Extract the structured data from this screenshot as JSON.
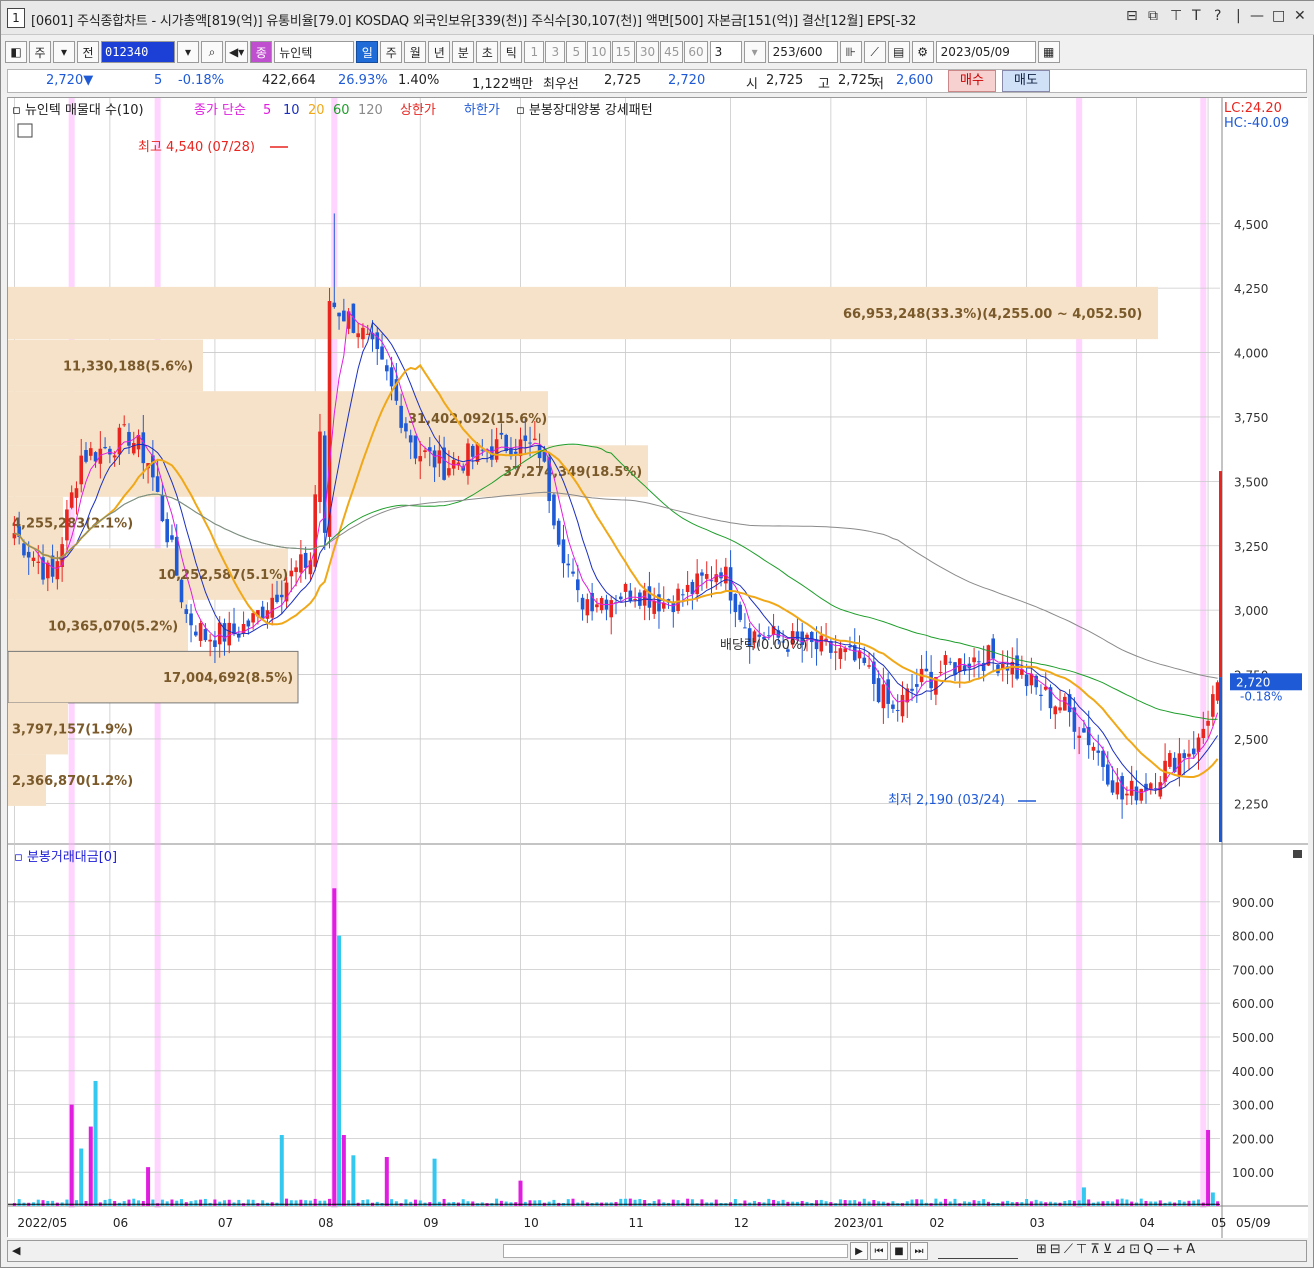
{
  "window": {
    "number": "1",
    "title": "[0601] 주식종합차트 - 시가총액[819(억)] 유통비율[79.0] KOSDAQ 외국인보유[339(천)] 주식수[30,107(천)] 액면[500] 자본금[151(억)] 결산[12월] EPS[-32",
    "ctrl": [
      "⊟",
      "⧉",
      "⊤",
      "T",
      "?",
      "|",
      "—",
      "□",
      "✕"
    ]
  },
  "toolbar": {
    "mode1": "주",
    "mode2": "전",
    "code": "012340",
    "search_icon": "search-icon",
    "name_badge": "종",
    "name": "뉴인텍",
    "periods": [
      "일",
      "주",
      "월",
      "년",
      "분",
      "초",
      "틱"
    ],
    "numbers": [
      "1",
      "3",
      "5",
      "10",
      "15",
      "30",
      "45",
      "60"
    ],
    "step": "3",
    "count": "253",
    "max": "/600",
    "date": "2023/05/09"
  },
  "quote": {
    "price": "2,720▼",
    "change": "5",
    "rate": "-0.18%",
    "volume": "422,664",
    "vol_rate": "26.93%",
    "turnover": "1.40%",
    "amount": "1,122백만",
    "best_ask_label": "최우선",
    "best_ask": "2,725",
    "best_bid": "2,720",
    "open_label": "시",
    "open": "2,725",
    "high_label": "고",
    "high": "2,725",
    "low_label": "저",
    "low": "2,600",
    "buy": "매수",
    "sell": "매도"
  },
  "legend": {
    "vp": "뉴인텍 매물대 수(10)",
    "ma": "종가 단순",
    "ma5": "5",
    "ma10": "10",
    "ma20": "20",
    "ma60": "60",
    "ma120": "120",
    "upper": "상한가",
    "lower": "하한가",
    "pattern": "분봉장대양봉 강세패턴",
    "lc": "LC:24.20",
    "hc": "HC:-40.09"
  },
  "colors": {
    "up": "#e8251f",
    "down": "#1f5ad6",
    "ma5": "#e01ee0",
    "ma10": "#1b2fbf",
    "ma20": "#f0a818",
    "ma60": "#1e9e2a",
    "ma120": "#8a8a8a",
    "profile": "#f6e2c8",
    "hl": "#ffb0ff"
  },
  "annotations": {
    "high": "최고 4,540 (07/28)",
    "low": "최저 2,190 (03/24)",
    "dividend": "배당락(0.00%)"
  },
  "price_axis": [
    "4,500",
    "4,250",
    "4,000",
    "3,750",
    "3,500",
    "3,250",
    "3,000",
    "2,750",
    "2,500",
    "2,250"
  ],
  "current_price": "2,720",
  "current_rate": "-0.18%",
  "volume_profile": [
    {
      "label": "66,953,248(33.3%)(4,255.00 ~ 4,052.50)"
    },
    {
      "label": "11,330,188(5.6%)"
    },
    {
      "label": "31,402,092(15.6%)"
    },
    {
      "label": "37,274,349(18.5%)"
    },
    {
      "label": "4,255,283(2.1%)"
    },
    {
      "label": "10,252,587(5.1%)"
    },
    {
      "label": "10,365,070(5.2%)"
    },
    {
      "label": "17,004,692(8.5%)"
    },
    {
      "label": "3,797,157(1.9%)"
    },
    {
      "label": "2,366,870(1.2%)"
    }
  ],
  "volume_panel": {
    "title": "분봉거래대금[0]",
    "axis": [
      "900.00",
      "800.00",
      "700.00",
      "600.00",
      "500.00",
      "400.00",
      "300.00",
      "200.00",
      "100.00"
    ]
  },
  "x_axis": [
    "2022/05",
    "06",
    "07",
    "08",
    "09",
    "10",
    "11",
    "12",
    "2023/01",
    "02",
    "03",
    "04",
    "05"
  ],
  "x_axis_end": "05/09",
  "chart_data": {
    "type": "candlestick",
    "ylim": [
      2100,
      4600
    ],
    "days": 253,
    "high": {
      "value": 4540,
      "date": "07/28"
    },
    "low": {
      "value": 2190,
      "date": "03/24"
    },
    "last_close": 2720,
    "close_path": [
      [
        0,
        3300
      ],
      [
        8,
        3120
      ],
      [
        14,
        3600
      ],
      [
        18,
        3620
      ],
      [
        24,
        3680
      ],
      [
        28,
        3580
      ],
      [
        32,
        3300
      ],
      [
        36,
        2980
      ],
      [
        40,
        2900
      ],
      [
        46,
        2910
      ],
      [
        50,
        2960
      ],
      [
        56,
        3100
      ],
      [
        62,
        3200
      ],
      [
        66,
        4200
      ],
      [
        72,
        4100
      ],
      [
        78,
        3900
      ],
      [
        84,
        3620
      ],
      [
        90,
        3560
      ],
      [
        96,
        3600
      ],
      [
        104,
        3650
      ],
      [
        110,
        3620
      ],
      [
        114,
        3300
      ],
      [
        118,
        3040
      ],
      [
        124,
        3050
      ],
      [
        130,
        3080
      ],
      [
        136,
        3030
      ],
      [
        142,
        3080
      ],
      [
        148,
        3170
      ],
      [
        154,
        2910
      ],
      [
        160,
        2890
      ],
      [
        166,
        2860
      ],
      [
        172,
        2840
      ],
      [
        178,
        2780
      ],
      [
        184,
        2600
      ],
      [
        190,
        2730
      ],
      [
        196,
        2780
      ],
      [
        202,
        2820
      ],
      [
        208,
        2800
      ],
      [
        214,
        2690
      ],
      [
        220,
        2620
      ],
      [
        226,
        2480
      ],
      [
        232,
        2270
      ],
      [
        238,
        2340
      ],
      [
        244,
        2440
      ],
      [
        248,
        2480
      ],
      [
        252,
        2720
      ]
    ]
  },
  "volume_bars": [
    {
      "day": 12,
      "value": 300
    },
    {
      "day": 14,
      "value": 170
    },
    {
      "day": 16,
      "value": 235
    },
    {
      "day": 17,
      "value": 370
    },
    {
      "day": 28,
      "value": 115
    },
    {
      "day": 56,
      "value": 210
    },
    {
      "day": 67,
      "value": 940
    },
    {
      "day": 68,
      "value": 800
    },
    {
      "day": 69,
      "value": 210
    },
    {
      "day": 71,
      "value": 150
    },
    {
      "day": 78,
      "value": 145
    },
    {
      "day": 88,
      "value": 140
    },
    {
      "day": 106,
      "value": 75
    },
    {
      "day": 224,
      "value": 55
    },
    {
      "day": 250,
      "value": 225
    },
    {
      "day": 251,
      "value": 40
    }
  ],
  "highlight_days": [
    12,
    30,
    67,
    223,
    249
  ],
  "statusbar": {
    "controls": [
      "▶",
      "⏮",
      "■",
      "⏭"
    ],
    "tools": [
      "⊞",
      "⊟",
      "⟋",
      "⊤",
      "⊼",
      "⊻",
      "⊿",
      "⊡",
      "Q",
      "—",
      "+",
      "A"
    ]
  }
}
